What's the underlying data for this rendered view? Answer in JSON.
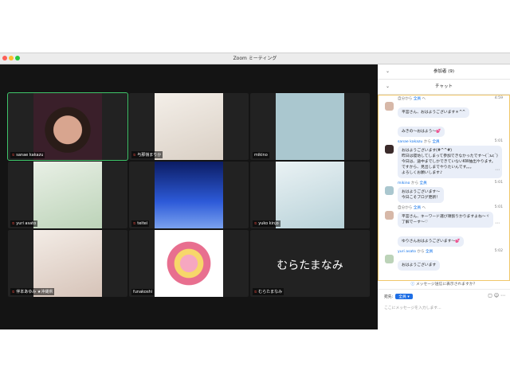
{
  "window": {
    "title": "Zoom ミーティング"
  },
  "participants": [
    {
      "name": "sanae kakazu",
      "active": true
    },
    {
      "name": "与那嶺まりか"
    },
    {
      "name": "mikino"
    },
    {
      "name": "yuri asato"
    },
    {
      "name": "teitei"
    },
    {
      "name": "yuko kinjo"
    },
    {
      "name": "伴本あゆみ ★沖縄県"
    },
    {
      "name": "funakoshi"
    },
    {
      "name": "むらたまなみ",
      "big_label": "むらたまなみ"
    }
  ],
  "panel": {
    "participants_header": "参加者 (9)",
    "chat_header": "チャット"
  },
  "chat": [
    {
      "from": "自分から",
      "to": "全員",
      "time": "4:59",
      "text": "平宮さん、おはようございます＊^^"
    },
    {
      "from": "",
      "to": "",
      "time": "",
      "text": "みきの～おはよう～💕"
    },
    {
      "from": "sanae kakazu",
      "to": "全員",
      "time": "5:01",
      "text": "おはようございます(#^^#)\n昨日は寝坊してしまって参加できなかったです～(´;ω;`)\n今日は、途中までしかできていないKW抽出やります。\nですから、見出しまでやりたいんです。。。\nよろしくお願いします♪"
    },
    {
      "from": "mikino",
      "to": "全員",
      "time": "5:01",
      "text": "おはようございます～\n今日こそブログ更新！"
    },
    {
      "from": "自分から",
      "to": "全員",
      "time": "5:01",
      "text": "平宮さん、キーワード選び頑張りかりますよね～ヾ\n了解でーす～♡"
    },
    {
      "from": "",
      "to": "",
      "time": "",
      "text": "ゆりさんおはようございます～💕"
    },
    {
      "from": "yuri asato",
      "to": "全員",
      "time": "5:02",
      "text": "おはようございます"
    }
  ],
  "footer": {
    "notice": "メッセージ送信に表示されますか？",
    "to_label": "宛先:",
    "to_value": "全員",
    "placeholder": "ここにメッセージを入力します..."
  }
}
